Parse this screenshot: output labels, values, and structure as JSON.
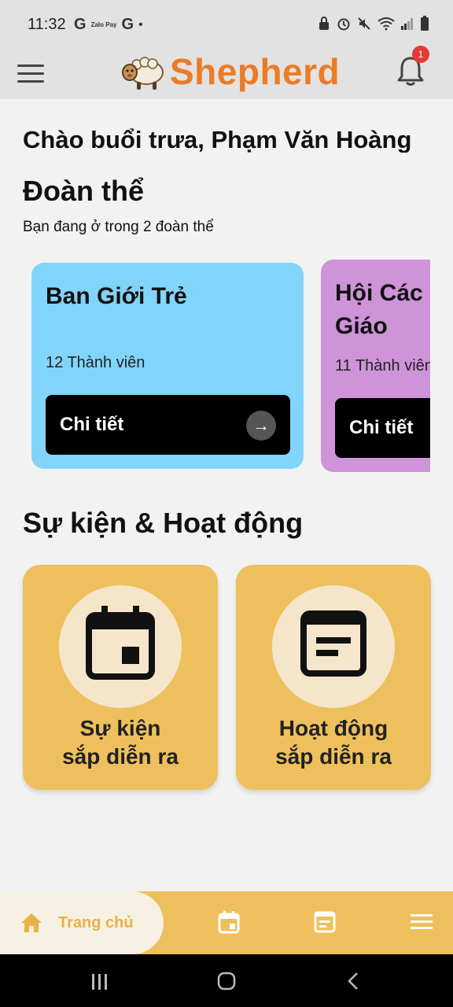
{
  "status_bar": {
    "time": "11:32",
    "left_icons": [
      "G",
      "Zalo Pay",
      "G",
      "•"
    ]
  },
  "header": {
    "app_name": "Shepherd",
    "notification_count": "1"
  },
  "greeting": "Chào buổi trưa, Phạm Văn Hoàng",
  "groups_section": {
    "title": "Đoàn thể",
    "subtitle": "Bạn đang ở trong 2 đoàn thể",
    "cards": [
      {
        "name": "Ban Giới Trẻ",
        "members": "12 Thành viên",
        "button": "Chi tiết",
        "color": "#81d4fa"
      },
      {
        "name": "Hội Các Giáo",
        "members": "11 Thành viên",
        "button": "Chi tiết",
        "color": "#ce93d8"
      }
    ]
  },
  "events_section": {
    "title": "Sự kiện & Hoạt động",
    "cards": [
      {
        "line1": "Sự kiện",
        "line2": "sắp diễn ra",
        "icon": "calendar-icon"
      },
      {
        "line1": "Hoạt động",
        "line2": "sắp diễn ra",
        "icon": "activity-list-icon"
      }
    ]
  },
  "bottom_nav": {
    "items": [
      {
        "label": "Trang chủ",
        "icon": "home-icon",
        "active": true
      },
      {
        "label": "",
        "icon": "calendar-icon"
      },
      {
        "label": "",
        "icon": "note-icon"
      },
      {
        "label": "",
        "icon": "menu-icon"
      }
    ]
  },
  "colors": {
    "brand": "#ec7b25",
    "accent": "#eec05d",
    "card_blue": "#81d4fa",
    "card_purple": "#ce93d8"
  }
}
